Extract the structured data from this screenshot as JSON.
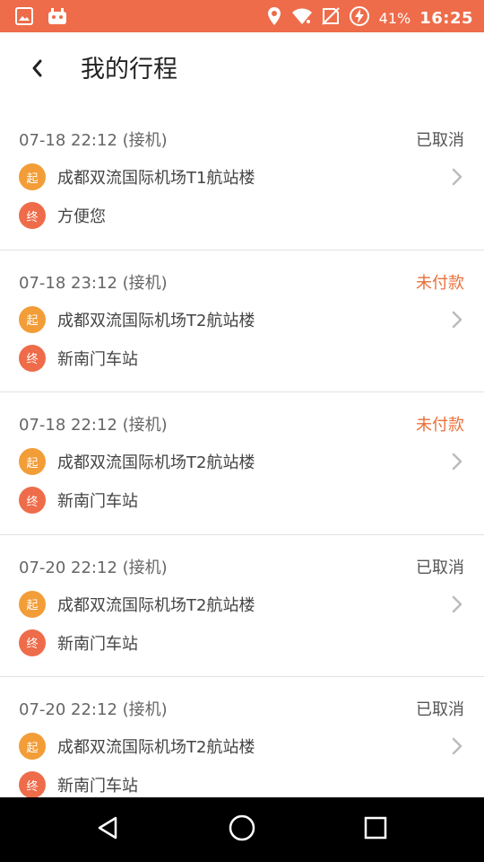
{
  "status_bar": {
    "battery_percent": "41%",
    "time": "16:25",
    "icons": [
      "image-icon",
      "android-app-icon",
      "location-icon",
      "wifi-icon",
      "no-sim-icon",
      "battery-charging-icon"
    ]
  },
  "header": {
    "title": "我的行程",
    "back_icon": "back-chevron-icon"
  },
  "colors": {
    "status_bar": "#ee6c4a",
    "start_badge": "#f29d38",
    "end_badge": "#ee6c4a",
    "unpaid": "#e8703a",
    "cancelled": "#555555"
  },
  "trips": [
    {
      "time": "07-18  22:12 (接机)",
      "status": "已取消",
      "status_type": "cancelled",
      "start_badge": "起",
      "start": "成都双流国际机场T1航站楼",
      "end_badge": "终",
      "end": "方便您"
    },
    {
      "time": "07-18  23:12 (接机)",
      "status": "未付款",
      "status_type": "unpaid",
      "start_badge": "起",
      "start": "成都双流国际机场T2航站楼",
      "end_badge": "终",
      "end": "新南门车站"
    },
    {
      "time": "07-18  22:12 (接机)",
      "status": "未付款",
      "status_type": "unpaid",
      "start_badge": "起",
      "start": "成都双流国际机场T2航站楼",
      "end_badge": "终",
      "end": "新南门车站"
    },
    {
      "time": "07-20  22:12 (接机)",
      "status": "已取消",
      "status_type": "cancelled",
      "start_badge": "起",
      "start": "成都双流国际机场T2航站楼",
      "end_badge": "终",
      "end": "新南门车站"
    },
    {
      "time": "07-20  22:12 (接机)",
      "status": "已取消",
      "status_type": "cancelled",
      "start_badge": "起",
      "start": "成都双流国际机场T2航站楼",
      "end_badge": "终",
      "end": "新南门车站"
    }
  ],
  "nav_bar": {
    "icons": [
      "back-triangle-icon",
      "home-circle-icon",
      "recents-square-icon"
    ]
  }
}
